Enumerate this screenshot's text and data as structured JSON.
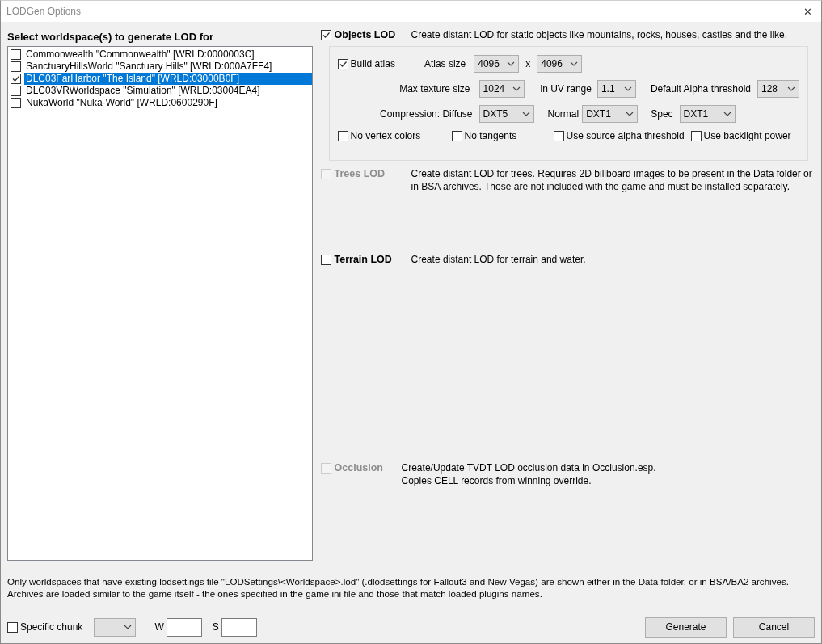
{
  "window": {
    "title": "LODGen Options",
    "close": "✕"
  },
  "worldspaces": {
    "heading": "Select worldspace(s) to generate LOD for",
    "items": [
      {
        "label": "Commonwealth \"Commonwealth\" [WRLD:0000003C]",
        "checked": false,
        "selected": false
      },
      {
        "label": "SanctuaryHillsWorld \"Sanctuary Hills\" [WRLD:000A7FF4]",
        "checked": false,
        "selected": false
      },
      {
        "label": "DLC03FarHarbor \"The Island\" [WRLD:03000B0F]",
        "checked": true,
        "selected": true
      },
      {
        "label": "DLC03VRWorldspace \"Simulation\" [WRLD:03004EA4]",
        "checked": false,
        "selected": false
      },
      {
        "label": "NukaWorld \"Nuka-World\" [WRLD:0600290F]",
        "checked": false,
        "selected": false
      }
    ]
  },
  "sections": [
    {
      "kind": "objects",
      "label": "Objects LOD",
      "checked": true,
      "disabled": false,
      "description": [
        "Create distant LOD for static objects like mountains, rocks, houses, castles and the like."
      ],
      "options": [
        [
          {
            "kind": "checkbox",
            "label": "Build atlas",
            "checked": true
          },
          {
            "kind": "label",
            "text": "Atlas size"
          },
          {
            "kind": "dropdown",
            "value": "4096"
          },
          {
            "kind": "label",
            "text": "x"
          },
          {
            "kind": "dropdown",
            "value": "4096"
          }
        ],
        [
          {
            "kind": "label",
            "text": "Max texture size"
          },
          {
            "kind": "dropdown",
            "value": "1024"
          },
          {
            "kind": "label",
            "text": "in UV range"
          },
          {
            "kind": "dropdown",
            "value": "1.1"
          },
          {
            "kind": "label",
            "text": "Default Alpha threshold"
          },
          {
            "kind": "dropdown",
            "value": "128"
          }
        ],
        [
          {
            "kind": "label",
            "text": "Compression: Diffuse"
          },
          {
            "kind": "dropdown",
            "value": "DXT5"
          },
          {
            "kind": "label",
            "text": "Normal"
          },
          {
            "kind": "dropdown",
            "value": "DXT1"
          },
          {
            "kind": "label",
            "text": "Spec"
          },
          {
            "kind": "dropdown",
            "value": "DXT1"
          }
        ],
        [
          {
            "kind": "checkbox",
            "label": "No vertex colors",
            "checked": false
          },
          {
            "kind": "checkbox",
            "label": "No tangents",
            "checked": false
          },
          {
            "kind": "checkbox",
            "label": "Use source alpha threshold",
            "checked": false
          },
          {
            "kind": "checkbox",
            "label": "Use backlight power",
            "checked": false
          }
        ]
      ]
    },
    {
      "kind": "trees",
      "label": "Trees LOD",
      "checked": false,
      "disabled": true,
      "description": [
        "Create distant LOD for trees. Requires 2D billboard images to be present in the Data folder or in BSA archives. Those are not included with the game and must be installed separately."
      ]
    },
    {
      "kind": "terrain",
      "label": "Terrain LOD",
      "checked": false,
      "disabled": false,
      "description": [
        "Create distant LOD for terrain and water."
      ]
    },
    {
      "kind": "occlusion",
      "label": "Occlusion",
      "checked": false,
      "disabled": true,
      "description": [
        "Create/Update TVDT LOD occlusion data in Occlusion.esp.",
        "Copies CELL records from winning override."
      ]
    }
  ],
  "note": [
    "Only worldspaces that have existing lodsettings file \"LODSettings\\<Worldspace>.lod\" (.dlodsettings for Fallout3 and New Vegas) are shown either in the Data folder, or in BSA/BA2 archives.",
    "Archives are loaded similar to the game itself - the ones specified in the game ini file and those that match loaded plugins names."
  ],
  "footer": {
    "specific_chunk": {
      "label": "Specific chunk",
      "checked": false
    },
    "w_label": "W",
    "s_label": "S",
    "buttons": [
      "Generate",
      "Cancel"
    ]
  }
}
